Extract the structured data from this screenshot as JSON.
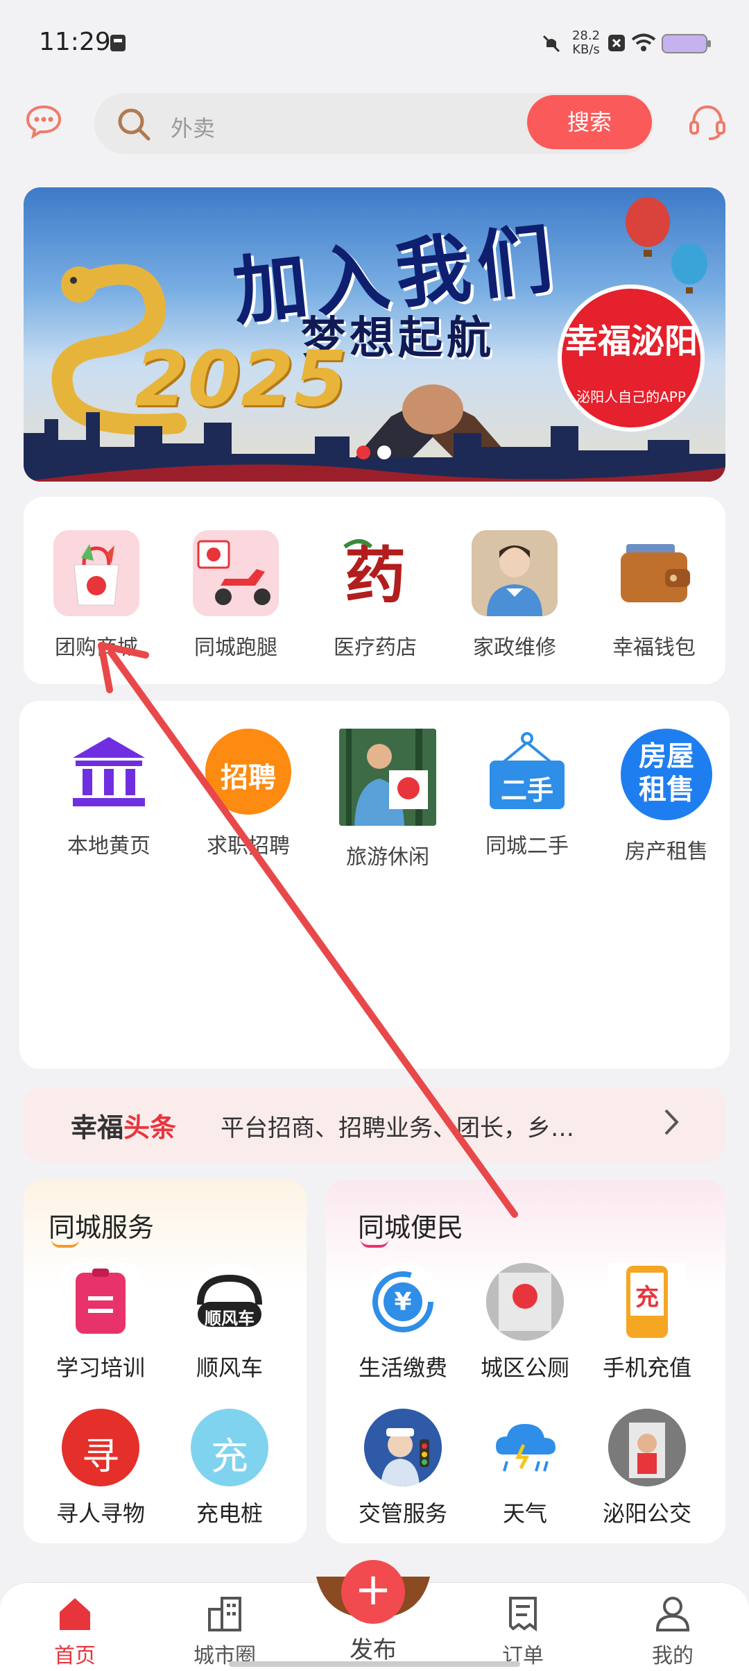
{
  "status": {
    "time": "11:29",
    "net_speed_value": "28.2",
    "net_speed_unit": "KB/s"
  },
  "search": {
    "placeholder": "外卖",
    "button": "搜索"
  },
  "banner": {
    "title": "加入我们",
    "subtitle": "梦想起航",
    "year": "2025",
    "badge_name": "幸福泌阳",
    "badge_tagline": "泌阳人自己的APP"
  },
  "grid1": [
    {
      "label": "团购商城",
      "icon": "shopping-bag-icon"
    },
    {
      "label": "同城跑腿",
      "icon": "delivery-scooter-icon"
    },
    {
      "label": "医疗药店",
      "icon": "medicine-icon"
    },
    {
      "label": "家政维修",
      "icon": "housekeeper-icon"
    },
    {
      "label": "幸福钱包",
      "icon": "wallet-icon"
    }
  ],
  "grid2": [
    {
      "label": "本地黄页",
      "icon": "bank-icon"
    },
    {
      "label": "求职招聘",
      "icon": "recruit-icon",
      "badge": "招聘"
    },
    {
      "label": "旅游休闲",
      "icon": "travel-icon"
    },
    {
      "label": "同城二手",
      "icon": "second-hand-icon",
      "badge": "二手"
    },
    {
      "label": "房产租售",
      "icon": "house-rent-icon",
      "badge": "房屋租售"
    }
  ],
  "news": {
    "brand_prefix": "幸福",
    "brand_suffix": "头条",
    "text": "平台招商、招聘业务、团长，乡…"
  },
  "services_left": {
    "title": "同城服务",
    "items": [
      {
        "label": "学习培训",
        "icon": "training-icon"
      },
      {
        "label": "顺风车",
        "icon": "carpool-icon",
        "badge": "顺风车"
      },
      {
        "label": "寻人寻物",
        "icon": "search-person-icon",
        "badge": "寻"
      },
      {
        "label": "充电桩",
        "icon": "charging-icon",
        "badge": "充"
      }
    ]
  },
  "services_right": {
    "title": "同城便民",
    "items": [
      {
        "label": "生活缴费",
        "icon": "bill-pay-icon",
        "badge": "¥"
      },
      {
        "label": "城区公厕",
        "icon": "toilet-icon"
      },
      {
        "label": "手机充值",
        "icon": "phone-topup-icon",
        "badge": "充"
      },
      {
        "label": "交管服务",
        "icon": "traffic-police-icon"
      },
      {
        "label": "天气",
        "icon": "weather-icon"
      },
      {
        "label": "泌阳公交",
        "icon": "bus-icon"
      }
    ]
  },
  "nav": {
    "home": "首页",
    "city": "城市圈",
    "post": "发布",
    "orders": "订单",
    "mine": "我的"
  },
  "colors": {
    "accent": "#fa5a5a",
    "brand_red": "#e8353b"
  }
}
